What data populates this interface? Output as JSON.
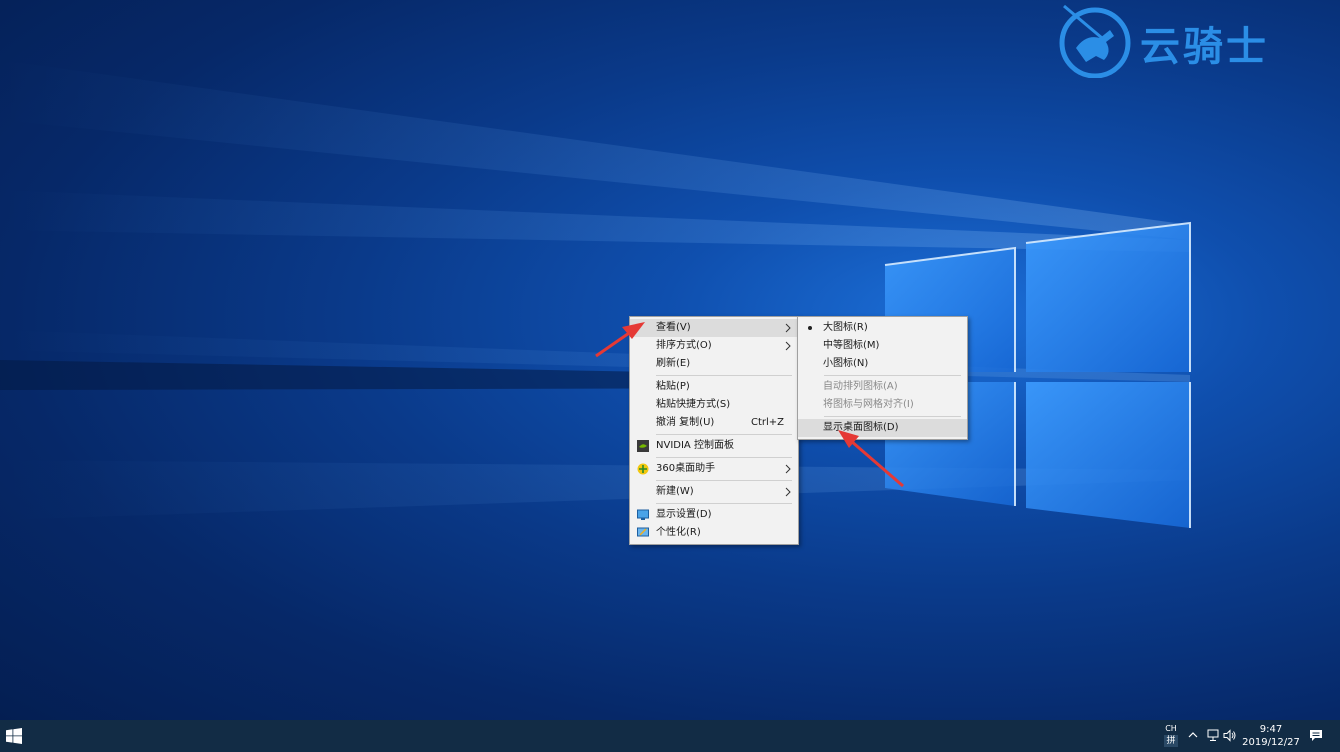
{
  "watermark": {
    "text": "云骑士"
  },
  "context_menu": {
    "items": [
      {
        "label": "查看(V)",
        "has_submenu": true,
        "highlighted": true
      },
      {
        "label": "排序方式(O)",
        "has_submenu": true
      },
      {
        "label": "刷新(E)"
      },
      {
        "label": "粘贴(P)"
      },
      {
        "label": "粘贴快捷方式(S)"
      },
      {
        "label": "撤消 复制(U)",
        "shortcut": "Ctrl+Z"
      },
      {
        "label": "NVIDIA 控制面板",
        "icon": "nvidia-icon"
      },
      {
        "label": "360桌面助手",
        "icon": "360-icon",
        "has_submenu": true
      },
      {
        "label": "新建(W)",
        "has_submenu": true
      },
      {
        "label": "显示设置(D)",
        "icon": "display-settings-icon"
      },
      {
        "label": "个性化(R)",
        "icon": "personalize-icon"
      }
    ]
  },
  "view_submenu": {
    "items": [
      {
        "label": "大图标(R)",
        "checked": true
      },
      {
        "label": "中等图标(M)"
      },
      {
        "label": "小图标(N)"
      },
      {
        "label": "自动排列图标(A)",
        "disabled": true
      },
      {
        "label": "将图标与网格对齐(I)",
        "disabled": true
      },
      {
        "label": "显示桌面图标(D)",
        "highlighted": true
      }
    ]
  },
  "taskbar": {
    "ime_line1": "CH",
    "ime_line2": "拼",
    "time": "9:47",
    "date": "2019/12/27"
  },
  "colors": {
    "menu_bg": "#f2f2f2",
    "menu_highlight": "#dcdcdc",
    "taskbar_bg": "#122c45",
    "annotation_arrow": "#e53935",
    "watermark": "#2b8ee6"
  }
}
